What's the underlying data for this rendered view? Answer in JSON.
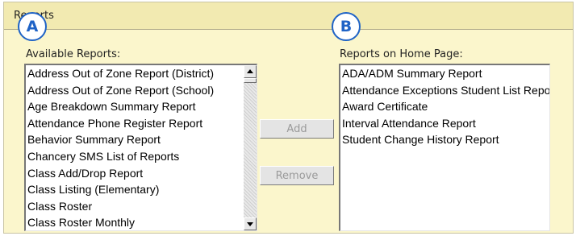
{
  "panel": {
    "title": "Reports"
  },
  "callouts": {
    "a": "A",
    "b": "B"
  },
  "available": {
    "label": "Available Reports:",
    "items": [
      "Address Out of Zone Report (District)",
      "Address Out of Zone Report (School)",
      "Age Breakdown Summary Report",
      "Attendance Phone Register Report",
      "Behavior Summary Report",
      "Chancery SMS List of Reports",
      "Class Add/Drop Report",
      "Class Listing (Elementary)",
      "Class Roster",
      "Class Roster Monthly"
    ]
  },
  "buttons": {
    "add": "Add",
    "remove": "Remove"
  },
  "home": {
    "label": "Reports on Home Page:",
    "items": [
      "ADA/ADM Summary Report",
      "Attendance Exceptions Student List Report",
      "Award Certificate",
      "Interval Attendance Report",
      "Student Change History Report"
    ]
  },
  "colors": {
    "callout": "#1f63c6",
    "panel_bg": "#fbf6cc",
    "header_bg": "#f2eab1"
  },
  "icons": {
    "scroll_up": "triangle-up",
    "scroll_down": "triangle-down"
  }
}
